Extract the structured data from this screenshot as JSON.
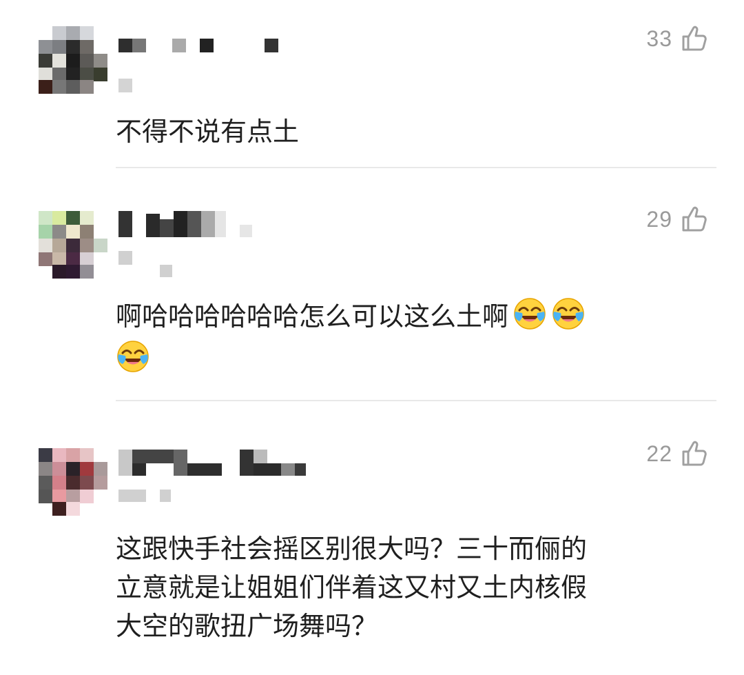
{
  "comments": [
    {
      "username": "",
      "likes": "33",
      "text": "不得不说有点土",
      "emoji": []
    },
    {
      "username": "",
      "likes": "29",
      "text": "啊哈哈哈哈哈哈怎么可以这么土啊",
      "emoji": [
        "laugh-cry-emoji",
        "laugh-cry-emoji",
        "laugh-cry-emoji"
      ]
    },
    {
      "username": "",
      "likes": "22",
      "text_lines": [
        "这跟快手社会摇区别很大吗？三十而俪的",
        "立意就是让姐姐们伴着这又村又土内核假",
        "大空的歌扭广场舞吗？"
      ],
      "emoji": []
    }
  ],
  "icons": {
    "like": "thumbs-up-icon",
    "emoji": "laugh-cry-emoji"
  },
  "colors": {
    "text": "#1f1f1f",
    "meta": "#9a9a9a",
    "divider": "#e8e8e8"
  }
}
